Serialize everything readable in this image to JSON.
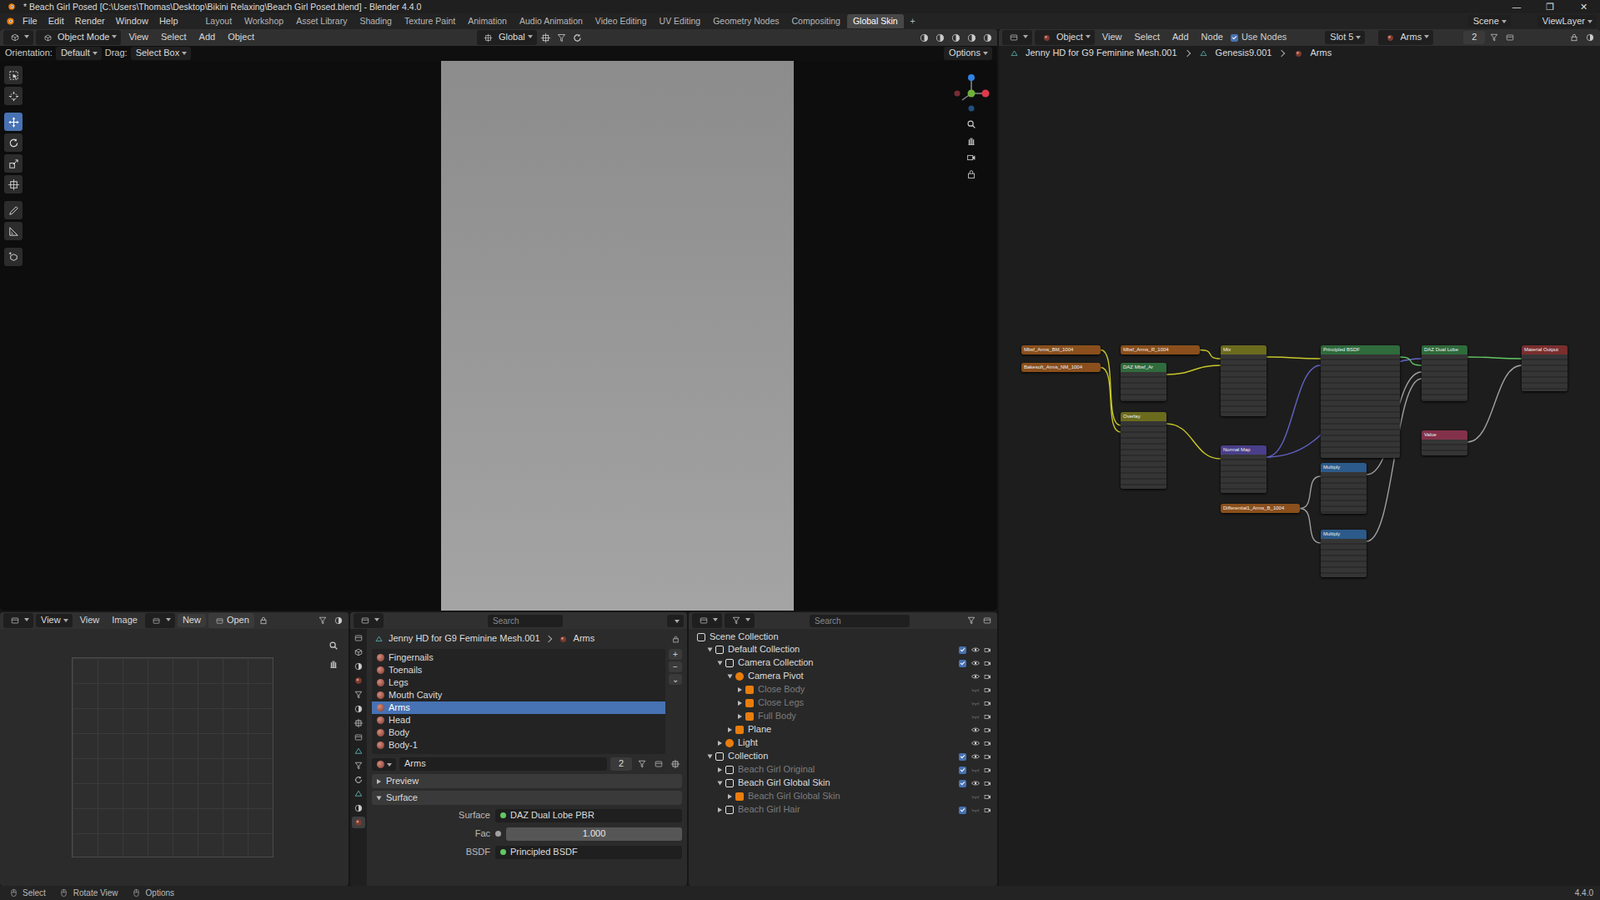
{
  "window": {
    "title": "* Beach Girl Posed [C:\\Users\\Thomas\\Desktop\\Bikini Relaxing\\Beach Girl Posed.blend] - Blender 4.4.0",
    "controls": [
      "—",
      "❐",
      "✕"
    ]
  },
  "menus": [
    "File",
    "Edit",
    "Render",
    "Window",
    "Help"
  ],
  "workspaces": [
    {
      "label": "Layout",
      "selected": false
    },
    {
      "label": "Workshop",
      "selected": false
    },
    {
      "label": "Asset Library",
      "selected": false
    },
    {
      "label": "Shading",
      "selected": false
    },
    {
      "label": "Texture Paint",
      "selected": false
    },
    {
      "label": "Animation",
      "selected": false
    },
    {
      "label": "Audio Animation",
      "selected": false
    },
    {
      "label": "Video Editing",
      "selected": false
    },
    {
      "label": "UV Editing",
      "selected": false
    },
    {
      "label": "Geometry Nodes",
      "selected": false
    },
    {
      "label": "Compositing",
      "selected": false
    },
    {
      "label": "Global Skin",
      "selected": true
    },
    {
      "label": "+",
      "selected": false
    }
  ],
  "topbar_right": {
    "scene": "Scene",
    "view_layer": "ViewLayer"
  },
  "viewport": {
    "header": {
      "mode": "Object Mode",
      "menus": [
        "View",
        "Select",
        "Add",
        "Object"
      ],
      "orientation": "Global"
    },
    "toolsettings": {
      "orientation_label": "Orientation:",
      "orientation": "Default",
      "drag_label": "Drag:",
      "drag": "Select Box",
      "options": "Options"
    },
    "tools": [
      {
        "selected": false
      },
      {
        "selected": false
      },
      {
        "selected": true
      },
      {
        "selected": false
      },
      {
        "selected": false
      },
      {
        "selected": false
      },
      {
        "selected": false
      },
      {
        "selected": false
      },
      {
        "selected": false
      }
    ]
  },
  "node_editor": {
    "header": {
      "type": "Object",
      "menus": [
        "View",
        "Select",
        "Add",
        "Node"
      ],
      "use_nodes": {
        "label": "Use Nodes",
        "checked": true
      },
      "slot": "Slot 5",
      "material": "Arms",
      "users": "2"
    },
    "breadcrumb": [
      "Jenny HD for G9 Feminine Mesh.001",
      "Genesis9.001",
      "Arms"
    ],
    "nodes": [
      {
        "title": "Mbsf_Arms_BM_1004",
        "color": "#8a4f1c"
      },
      {
        "title": "Bakesoft_Arms_NM_1004",
        "color": "#8a4f1c"
      },
      {
        "title": "Mbsf_Arms_R_1004",
        "color": "#8a4f1c"
      },
      {
        "title": "DAZ Mbsf_Ar",
        "color": "#2f6b3c"
      },
      {
        "title": "Overlay",
        "color": "#6b6b1e"
      },
      {
        "title": "Mix",
        "color": "#6b6b1e"
      },
      {
        "title": "Normal Map",
        "color": "#4a3f8a"
      },
      {
        "title": "Differential1_Arms_B_1004",
        "color": "#8a4f1c"
      },
      {
        "title": "Principled BSDF",
        "color": "#2f6b3c"
      },
      {
        "title": "Multiply",
        "color": "#2c5a8a"
      },
      {
        "title": "Multiply",
        "color": "#2c5a8a"
      },
      {
        "title": "DAZ Dual Lobe",
        "color": "#2f6b3c"
      },
      {
        "title": "Value",
        "color": "#83314a"
      },
      {
        "title": "Material Output",
        "color": "#7a2e2e"
      }
    ],
    "links": [
      {
        "from": 0,
        "to": 4,
        "color": "#c7c729"
      },
      {
        "from": 1,
        "to": 4,
        "color": "#c7c729"
      },
      {
        "from": 2,
        "to": 5,
        "color": "#c7c729"
      },
      {
        "from": 3,
        "to": 5,
        "color": "#c7c729"
      },
      {
        "from": 4,
        "to": 6,
        "color": "#c7c729"
      },
      {
        "from": 5,
        "to": 8,
        "color": "#c7c729"
      },
      {
        "from": 6,
        "to": 8,
        "color": "#6363c7"
      },
      {
        "from": 6,
        "to": 11,
        "color": "#6363c7"
      },
      {
        "from": 7,
        "to": 9,
        "color": "#a1a1a1"
      },
      {
        "from": 7,
        "to": 10,
        "color": "#a1a1a1"
      },
      {
        "from": 8,
        "to": 11,
        "color": "#63c763"
      },
      {
        "from": 9,
        "to": 11,
        "color": "#a1a1a1"
      },
      {
        "from": 10,
        "to": 11,
        "color": "#a1a1a1"
      },
      {
        "from": 11,
        "to": 13,
        "color": "#63c763"
      },
      {
        "from": 12,
        "to": 13,
        "color": "#a1a1a1"
      }
    ]
  },
  "image_editor": {
    "mode": "View",
    "menus": [
      "View",
      "Image"
    ],
    "new": "New",
    "open": "Open"
  },
  "properties": {
    "search": {
      "placeholder": "Search"
    },
    "breadcrumb": [
      "Jenny HD for G9 Feminine Mesh.001",
      "Arms"
    ],
    "tabs": [
      {
        "selected": false
      },
      {
        "selected": false
      },
      {
        "selected": false
      },
      {
        "selected": false
      },
      {
        "selected": false
      },
      {
        "selected": false
      },
      {
        "selected": false
      },
      {
        "selected": false
      },
      {
        "selected": false
      },
      {
        "selected": false
      },
      {
        "selected": false
      },
      {
        "selected": false
      },
      {
        "selected": false
      },
      {
        "selected": true
      }
    ],
    "slots": [
      {
        "label": "Fingernails",
        "selected": false
      },
      {
        "label": "Toenails",
        "selected": false
      },
      {
        "label": "Legs",
        "selected": false
      },
      {
        "label": "Mouth Cavity",
        "selected": false
      },
      {
        "label": "Arms",
        "selected": true
      },
      {
        "label": "Head",
        "selected": false
      },
      {
        "label": "Body",
        "selected": false
      },
      {
        "label": "Body-1",
        "selected": false
      }
    ],
    "slot_buttons": [
      "+",
      "−",
      "⌄"
    ],
    "material": {
      "name": "Arms",
      "users": "2"
    },
    "panels": [
      {
        "label": "Preview",
        "expanded": false
      },
      {
        "label": "Surface",
        "expanded": true
      }
    ],
    "fields": [
      {
        "label": "Surface",
        "value": "DAZ Dual Lobe PBR",
        "kind": "link"
      },
      {
        "label": "Fac",
        "value": "1.000",
        "kind": "slider",
        "level": 1
      },
      {
        "label": "BSDF",
        "value": "Principled BSDF",
        "kind": "link"
      }
    ]
  },
  "outliner": {
    "search": {
      "placeholder": "Search"
    },
    "items": [
      {
        "label": "Scene Collection",
        "depth": 0,
        "kind": "scene",
        "expanded": true,
        "enabled": true,
        "check": null,
        "visible": null
      },
      {
        "label": "Default Collection",
        "depth": 1,
        "kind": "collection",
        "expanded": true,
        "enabled": true,
        "check": true,
        "visible": true
      },
      {
        "label": "Camera Collection",
        "depth": 2,
        "kind": "collection",
        "expanded": true,
        "enabled": true,
        "check": true,
        "visible": true
      },
      {
        "label": "Camera Pivot",
        "depth": 3,
        "kind": "empty",
        "expanded": true,
        "enabled": true,
        "check": null,
        "visible": true
      },
      {
        "label": "Close Body",
        "depth": 4,
        "kind": "camera",
        "expanded": false,
        "enabled": false,
        "check": null,
        "visible": false
      },
      {
        "label": "Close Legs",
        "depth": 4,
        "kind": "camera",
        "expanded": false,
        "enabled": false,
        "check": null,
        "visible": false
      },
      {
        "label": "Full Body",
        "depth": 4,
        "kind": "camera",
        "expanded": false,
        "enabled": false,
        "check": null,
        "visible": false
      },
      {
        "label": "Plane",
        "depth": 3,
        "kind": "mesh",
        "expanded": false,
        "enabled": true,
        "check": null,
        "visible": true
      },
      {
        "label": "Light",
        "depth": 2,
        "kind": "light",
        "expanded": false,
        "enabled": true,
        "check": null,
        "visible": true
      },
      {
        "label": "Collection",
        "depth": 1,
        "kind": "collection",
        "expanded": true,
        "enabled": true,
        "check": true,
        "visible": true
      },
      {
        "label": "Beach Girl Original",
        "depth": 2,
        "kind": "collection",
        "expanded": false,
        "enabled": false,
        "check": true,
        "visible": false
      },
      {
        "label": "Beach Girl Global Skin",
        "depth": 2,
        "kind": "collection",
        "expanded": true,
        "enabled": true,
        "check": true,
        "visible": true
      },
      {
        "label": "Beach Girl Global Skin",
        "depth": 3,
        "kind": "armature",
        "expanded": false,
        "enabled": false,
        "check": null,
        "visible": false
      },
      {
        "label": "Beach Girl Hair",
        "depth": 2,
        "kind": "collection",
        "expanded": false,
        "enabled": false,
        "check": true,
        "visible": false
      }
    ]
  },
  "status_bar": {
    "items": [
      "Select",
      "Rotate View",
      "Options"
    ],
    "version": "4.4.0"
  }
}
